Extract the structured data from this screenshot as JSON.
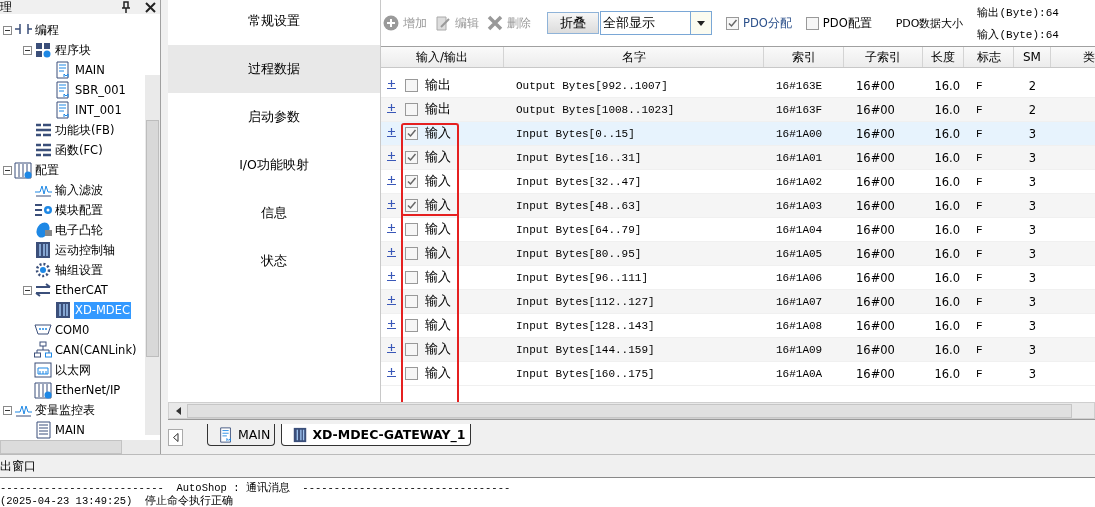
{
  "left_panel": {
    "title": "理",
    "tree": [
      {
        "label": "编程",
        "kind": "ladder",
        "selected": false,
        "expanded": true,
        "children": [
          {
            "label": "程序块",
            "kind": "blocks",
            "selected": false,
            "expanded": true,
            "children": [
              {
                "label": "MAIN",
                "kind": "program",
                "selected": false
              },
              {
                "label": "SBR_001",
                "kind": "program",
                "selected": false
              },
              {
                "label": "INT_001",
                "kind": "program",
                "selected": false
              }
            ]
          },
          {
            "label": "功能块(FB)",
            "kind": "list",
            "selected": false
          },
          {
            "label": "函数(FC)",
            "kind": "list",
            "selected": false
          }
        ]
      },
      {
        "label": "配置",
        "kind": "config",
        "selected": false,
        "expanded": true,
        "children": [
          {
            "label": "输入滤波",
            "kind": "wave",
            "selected": false
          },
          {
            "label": "模块配置",
            "kind": "module",
            "selected": false
          },
          {
            "label": "电子凸轮",
            "kind": "cam",
            "selected": false
          },
          {
            "label": "运动控制轴",
            "kind": "device",
            "selected": false
          },
          {
            "label": "轴组设置",
            "kind": "gear",
            "selected": false
          },
          {
            "label": "EtherCAT",
            "kind": "arrows",
            "selected": false,
            "expanded": true,
            "children": [
              {
                "label": "XD-MDEC",
                "kind": "device",
                "selected": true
              }
            ]
          },
          {
            "label": "COM0",
            "kind": "serial",
            "selected": false
          },
          {
            "label": "CAN(CANLink)",
            "kind": "network",
            "selected": false
          },
          {
            "label": "以太网",
            "kind": "ethernet",
            "selected": false
          },
          {
            "label": "EtherNet/IP",
            "kind": "config",
            "selected": false
          }
        ]
      },
      {
        "label": "变量监控表",
        "kind": "wave",
        "selected": false,
        "expanded": true,
        "children": [
          {
            "label": "MAIN",
            "kind": "listdoc",
            "selected": false
          }
        ]
      }
    ]
  },
  "nav": [
    {
      "label": "常规设置",
      "selected": false
    },
    {
      "label": "过程数据",
      "selected": true
    },
    {
      "label": "启动参数",
      "selected": false
    },
    {
      "label": "I/O功能映射",
      "selected": false
    },
    {
      "label": "信息",
      "selected": false
    },
    {
      "label": "状态",
      "selected": false
    }
  ],
  "toolbar": {
    "add": {
      "label": "增加",
      "disabled": true
    },
    "edit": {
      "label": "编辑",
      "disabled": true
    },
    "delete": {
      "label": "删除",
      "disabled": true
    },
    "collapse": "折叠",
    "filter": {
      "value": "全部显示"
    },
    "pdo_assign": {
      "label": "PDO分配",
      "checked": true
    },
    "pdo_config": {
      "label": "PDO配置",
      "checked": false
    },
    "size_label": "PDO数据大小",
    "output_size": "输出(Byte):64",
    "input_size": "输入(Byte):64"
  },
  "table": {
    "columns": [
      "输入/输出",
      "名字",
      "索引",
      "子索引",
      "长度",
      "标志",
      "SM",
      "类"
    ],
    "rows": [
      {
        "checked": false,
        "selected": false,
        "highlighted": false,
        "io": "输出",
        "name": "Output Bytes[992..1007]",
        "index": "16#163E",
        "subindex": "16#00",
        "length": "16.0",
        "flag": "F",
        "sm": "2"
      },
      {
        "checked": false,
        "selected": false,
        "highlighted": false,
        "io": "输出",
        "name": "Output Bytes[1008..1023]",
        "index": "16#163F",
        "subindex": "16#00",
        "length": "16.0",
        "flag": "F",
        "sm": "2"
      },
      {
        "checked": true,
        "selected": true,
        "highlighted": true,
        "io": "输入",
        "name": "Input Bytes[0..15]",
        "index": "16#1A00",
        "subindex": "16#00",
        "length": "16.0",
        "flag": "F",
        "sm": "3"
      },
      {
        "checked": true,
        "selected": false,
        "highlighted": true,
        "io": "输入",
        "name": "Input Bytes[16..31]",
        "index": "16#1A01",
        "subindex": "16#00",
        "length": "16.0",
        "flag": "F",
        "sm": "3"
      },
      {
        "checked": true,
        "selected": false,
        "highlighted": true,
        "io": "输入",
        "name": "Input Bytes[32..47]",
        "index": "16#1A02",
        "subindex": "16#00",
        "length": "16.0",
        "flag": "F",
        "sm": "3"
      },
      {
        "checked": true,
        "selected": false,
        "highlighted": true,
        "io": "输入",
        "name": "Input Bytes[48..63]",
        "index": "16#1A03",
        "subindex": "16#00",
        "length": "16.0",
        "flag": "F",
        "sm": "3"
      },
      {
        "checked": false,
        "selected": false,
        "highlighted": false,
        "io": "输入",
        "name": "Input Bytes[64..79]",
        "index": "16#1A04",
        "subindex": "16#00",
        "length": "16.0",
        "flag": "F",
        "sm": "3"
      },
      {
        "checked": false,
        "selected": false,
        "highlighted": false,
        "io": "输入",
        "name": "Input Bytes[80..95]",
        "index": "16#1A05",
        "subindex": "16#00",
        "length": "16.0",
        "flag": "F",
        "sm": "3"
      },
      {
        "checked": false,
        "selected": false,
        "highlighted": false,
        "io": "输入",
        "name": "Input Bytes[96..111]",
        "index": "16#1A06",
        "subindex": "16#00",
        "length": "16.0",
        "flag": "F",
        "sm": "3"
      },
      {
        "checked": false,
        "selected": false,
        "highlighted": false,
        "io": "输入",
        "name": "Input Bytes[112..127]",
        "index": "16#1A07",
        "subindex": "16#00",
        "length": "16.0",
        "flag": "F",
        "sm": "3"
      },
      {
        "checked": false,
        "selected": false,
        "highlighted": false,
        "io": "输入",
        "name": "Input Bytes[128..143]",
        "index": "16#1A08",
        "subindex": "16#00",
        "length": "16.0",
        "flag": "F",
        "sm": "3"
      },
      {
        "checked": false,
        "selected": false,
        "highlighted": false,
        "io": "输入",
        "name": "Input Bytes[144..159]",
        "index": "16#1A09",
        "subindex": "16#00",
        "length": "16.0",
        "flag": "F",
        "sm": "3"
      },
      {
        "checked": false,
        "selected": false,
        "highlighted": false,
        "io": "输入",
        "name": "Input Bytes[160..175]",
        "index": "16#1A0A",
        "subindex": "16#00",
        "length": "16.0",
        "flag": "F",
        "sm": "3"
      }
    ]
  },
  "tabs": [
    {
      "label": "MAIN",
      "kind": "program",
      "selected": false
    },
    {
      "label": "XD-MDEC-GATEWAY_1",
      "kind": "device",
      "selected": true
    }
  ],
  "output": {
    "title": "出窗口",
    "lines": [
      "--------------------------  AutoShop : 通讯消息  ---------------------------------",
      "(2025-04-23 13:49:25)  停止命令执行正确"
    ]
  }
}
